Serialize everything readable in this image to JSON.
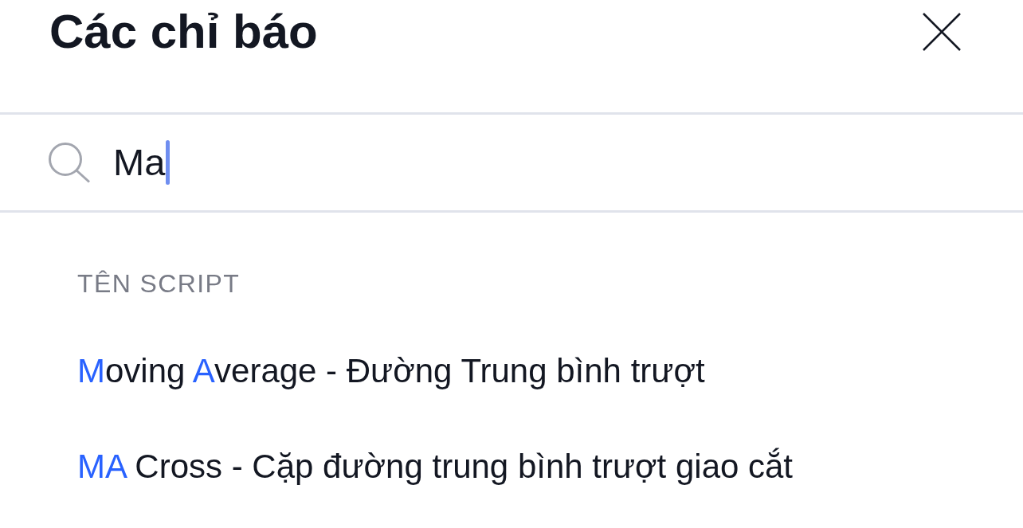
{
  "dialog": {
    "title": "Các chỉ báo"
  },
  "search": {
    "value": "Ma",
    "focused": true
  },
  "sections": [
    {
      "heading": "TÊN SCRIPT",
      "items": [
        {
          "segments": [
            {
              "text": "M",
              "highlight": true
            },
            {
              "text": "oving ",
              "highlight": false
            },
            {
              "text": "A",
              "highlight": true
            },
            {
              "text": "verage - Đường Trung bình trượt",
              "highlight": false
            }
          ]
        },
        {
          "segments": [
            {
              "text": "MA",
              "highlight": true
            },
            {
              "text": " Cross - Cặp đường trung bình trượt giao cắt",
              "highlight": false
            }
          ]
        }
      ]
    }
  ]
}
